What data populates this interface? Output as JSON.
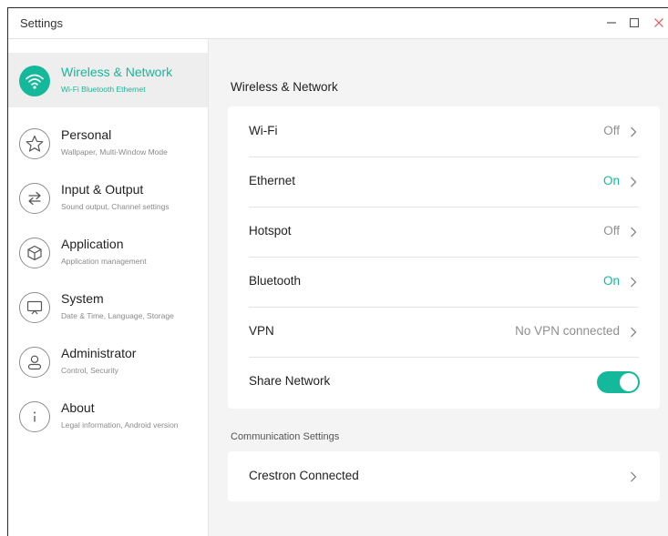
{
  "window": {
    "title": "Settings"
  },
  "colors": {
    "accent": "#15b89a",
    "close": "#e05555"
  },
  "sidebar": {
    "items": [
      {
        "title": "Wireless & Network",
        "subtitle": "Wi-Fi Bluetooth Ethernet",
        "icon": "wifi-icon",
        "active": true
      },
      {
        "title": "Personal",
        "subtitle": "Wallpaper, Multi-Window Mode",
        "icon": "star-icon"
      },
      {
        "title": "Input & Output",
        "subtitle": "Sound output, Channel settings",
        "icon": "arrows-exchange-icon"
      },
      {
        "title": "Application",
        "subtitle": "Application management",
        "icon": "cube-icon"
      },
      {
        "title": "System",
        "subtitle": "Date & Time, Language, Storage",
        "icon": "monitor-icon"
      },
      {
        "title": "Administrator",
        "subtitle": "Control, Security",
        "icon": "user-icon"
      },
      {
        "title": "About",
        "subtitle": "Legal information, Android version",
        "icon": "info-icon"
      }
    ]
  },
  "main": {
    "section_title": "Wireless & Network",
    "rows": [
      {
        "label": "Wi-Fi",
        "value": "Off"
      },
      {
        "label": "Ethernet",
        "value": "On"
      },
      {
        "label": "Hotspot",
        "value": "Off"
      },
      {
        "label": "Bluetooth",
        "value": "On"
      },
      {
        "label": "VPN",
        "value": "No VPN connected"
      },
      {
        "label": "Share Network",
        "toggle": true
      }
    ],
    "communication": {
      "title": "Communication Settings",
      "rows": [
        {
          "label": "Crestron Connected"
        }
      ]
    }
  }
}
